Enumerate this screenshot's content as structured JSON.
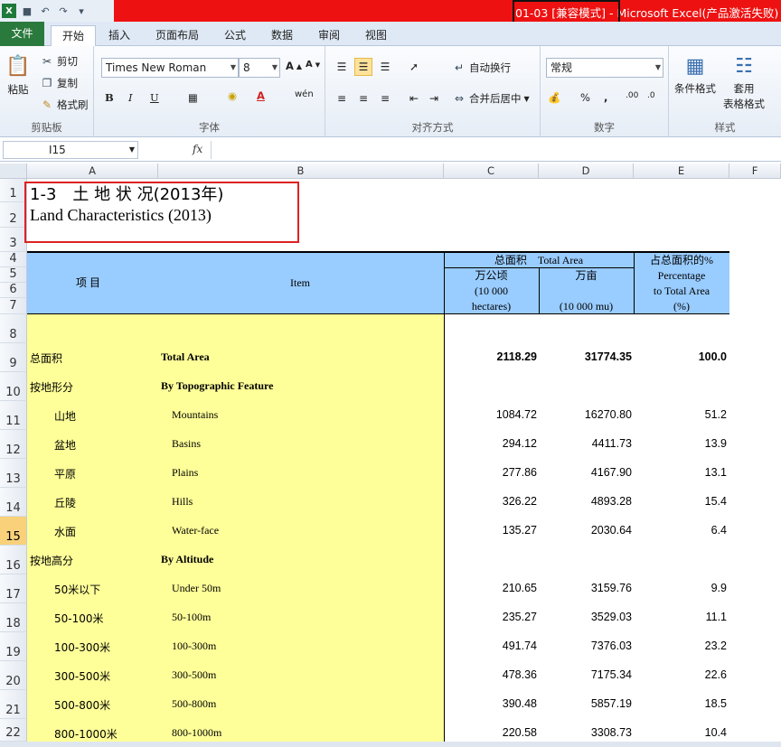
{
  "window": {
    "title": "01-03  [兼容模式]  - Microsoft Excel(产品激活失败)"
  },
  "tabs": [
    "文件",
    "开始",
    "插入",
    "页面布局",
    "公式",
    "数据",
    "审阅",
    "视图"
  ],
  "ribbon": {
    "clipboard": {
      "paste": "粘贴",
      "cut": "剪切",
      "copy": "复制",
      "format_painter": "格式刷",
      "label": "剪贴板"
    },
    "font": {
      "name": "Times New Roman",
      "size": "8",
      "label": "字体"
    },
    "alignment": {
      "wrap": "自动换行",
      "merge": "合并后居中",
      "label": "对齐方式"
    },
    "number": {
      "format": "常规",
      "label": "数字"
    },
    "styles": {
      "conditional": "条件格式",
      "table_line1": "套用",
      "table_line2": "表格格式",
      "label": "样式"
    }
  },
  "formula_bar": {
    "name_box": "I15",
    "fx": "fx",
    "value": ""
  },
  "columns": [
    "A",
    "B",
    "C",
    "D",
    "E",
    "F"
  ],
  "rows": [
    "1",
    "2",
    "3",
    "4",
    "5",
    "6",
    "7",
    "8",
    "9",
    "10",
    "11",
    "12",
    "13",
    "14",
    "15",
    "16",
    "17",
    "18",
    "19",
    "20",
    "21",
    "22"
  ],
  "sheet": {
    "title_cn": "1-3　土 地 状 况(2013年)",
    "title_en": "Land Characteristics (2013)",
    "header": {
      "item_cn": "项  目",
      "item_en": "Item",
      "total_area": "总面积　Total Area",
      "wan_gongqing": "万公顷",
      "ten_thousand": "(10 000",
      "hectares": "hectares)",
      "wan_mu": "万亩",
      "mu_unit": "(10 000 mu)",
      "pct_cn": "占总面积的%",
      "pct_en1": "Percentage",
      "pct_en2": "to Total Area",
      "pct_en3": "(%)"
    },
    "data_rows": [
      {
        "cn": "总面积",
        "en": "Total Area",
        "c": "2118.29",
        "d": "31774.35",
        "e": "100.0",
        "bold": true,
        "indent": false
      },
      {
        "cn": "按地形分",
        "en": "By Topographic Feature",
        "c": "",
        "d": "",
        "e": "",
        "bold": false,
        "en_bold": true,
        "indent": false
      },
      {
        "cn": "山地",
        "en": "Mountains",
        "c": "1084.72",
        "d": "16270.80",
        "e": "51.2",
        "indent": true
      },
      {
        "cn": "盆地",
        "en": "Basins",
        "c": "294.12",
        "d": "4411.73",
        "e": "13.9",
        "indent": true
      },
      {
        "cn": "平原",
        "en": "Plains",
        "c": "277.86",
        "d": "4167.90",
        "e": "13.1",
        "indent": true
      },
      {
        "cn": "丘陵",
        "en": "Hills",
        "c": "326.22",
        "d": "4893.28",
        "e": "15.4",
        "indent": true
      },
      {
        "cn": "水面",
        "en": "Water-face",
        "c": "135.27",
        "d": "2030.64",
        "e": "6.4",
        "indent": true
      },
      {
        "cn": "按地高分",
        "en": "By Altitude",
        "c": "",
        "d": "",
        "e": "",
        "bold": false,
        "en_bold": true,
        "indent": false
      },
      {
        "cn": "50米以下",
        "en": "Under 50m",
        "c": "210.65",
        "d": "3159.76",
        "e": "9.9",
        "indent": true
      },
      {
        "cn": "50-100米",
        "en": "50-100m",
        "c": "235.27",
        "d": "3529.03",
        "e": "11.1",
        "indent": true
      },
      {
        "cn": "100-300米",
        "en": "100-300m",
        "c": "491.74",
        "d": "7376.03",
        "e": "23.2",
        "indent": true
      },
      {
        "cn": "300-500米",
        "en": "300-500m",
        "c": "478.36",
        "d": "7175.34",
        "e": "22.6",
        "indent": true
      },
      {
        "cn": "500-800米",
        "en": "500-800m",
        "c": "390.48",
        "d": "5857.19",
        "e": "18.5",
        "indent": true
      },
      {
        "cn": "800-1000米",
        "en": "800-1000m",
        "c": "220.58",
        "d": "3308.73",
        "e": "10.4",
        "indent": true
      }
    ]
  },
  "colors": {
    "header_fill": "#99ccff",
    "item_fill": "#ffff99",
    "title_bar": "#ee1111",
    "file_tab": "#2b7a3d"
  }
}
